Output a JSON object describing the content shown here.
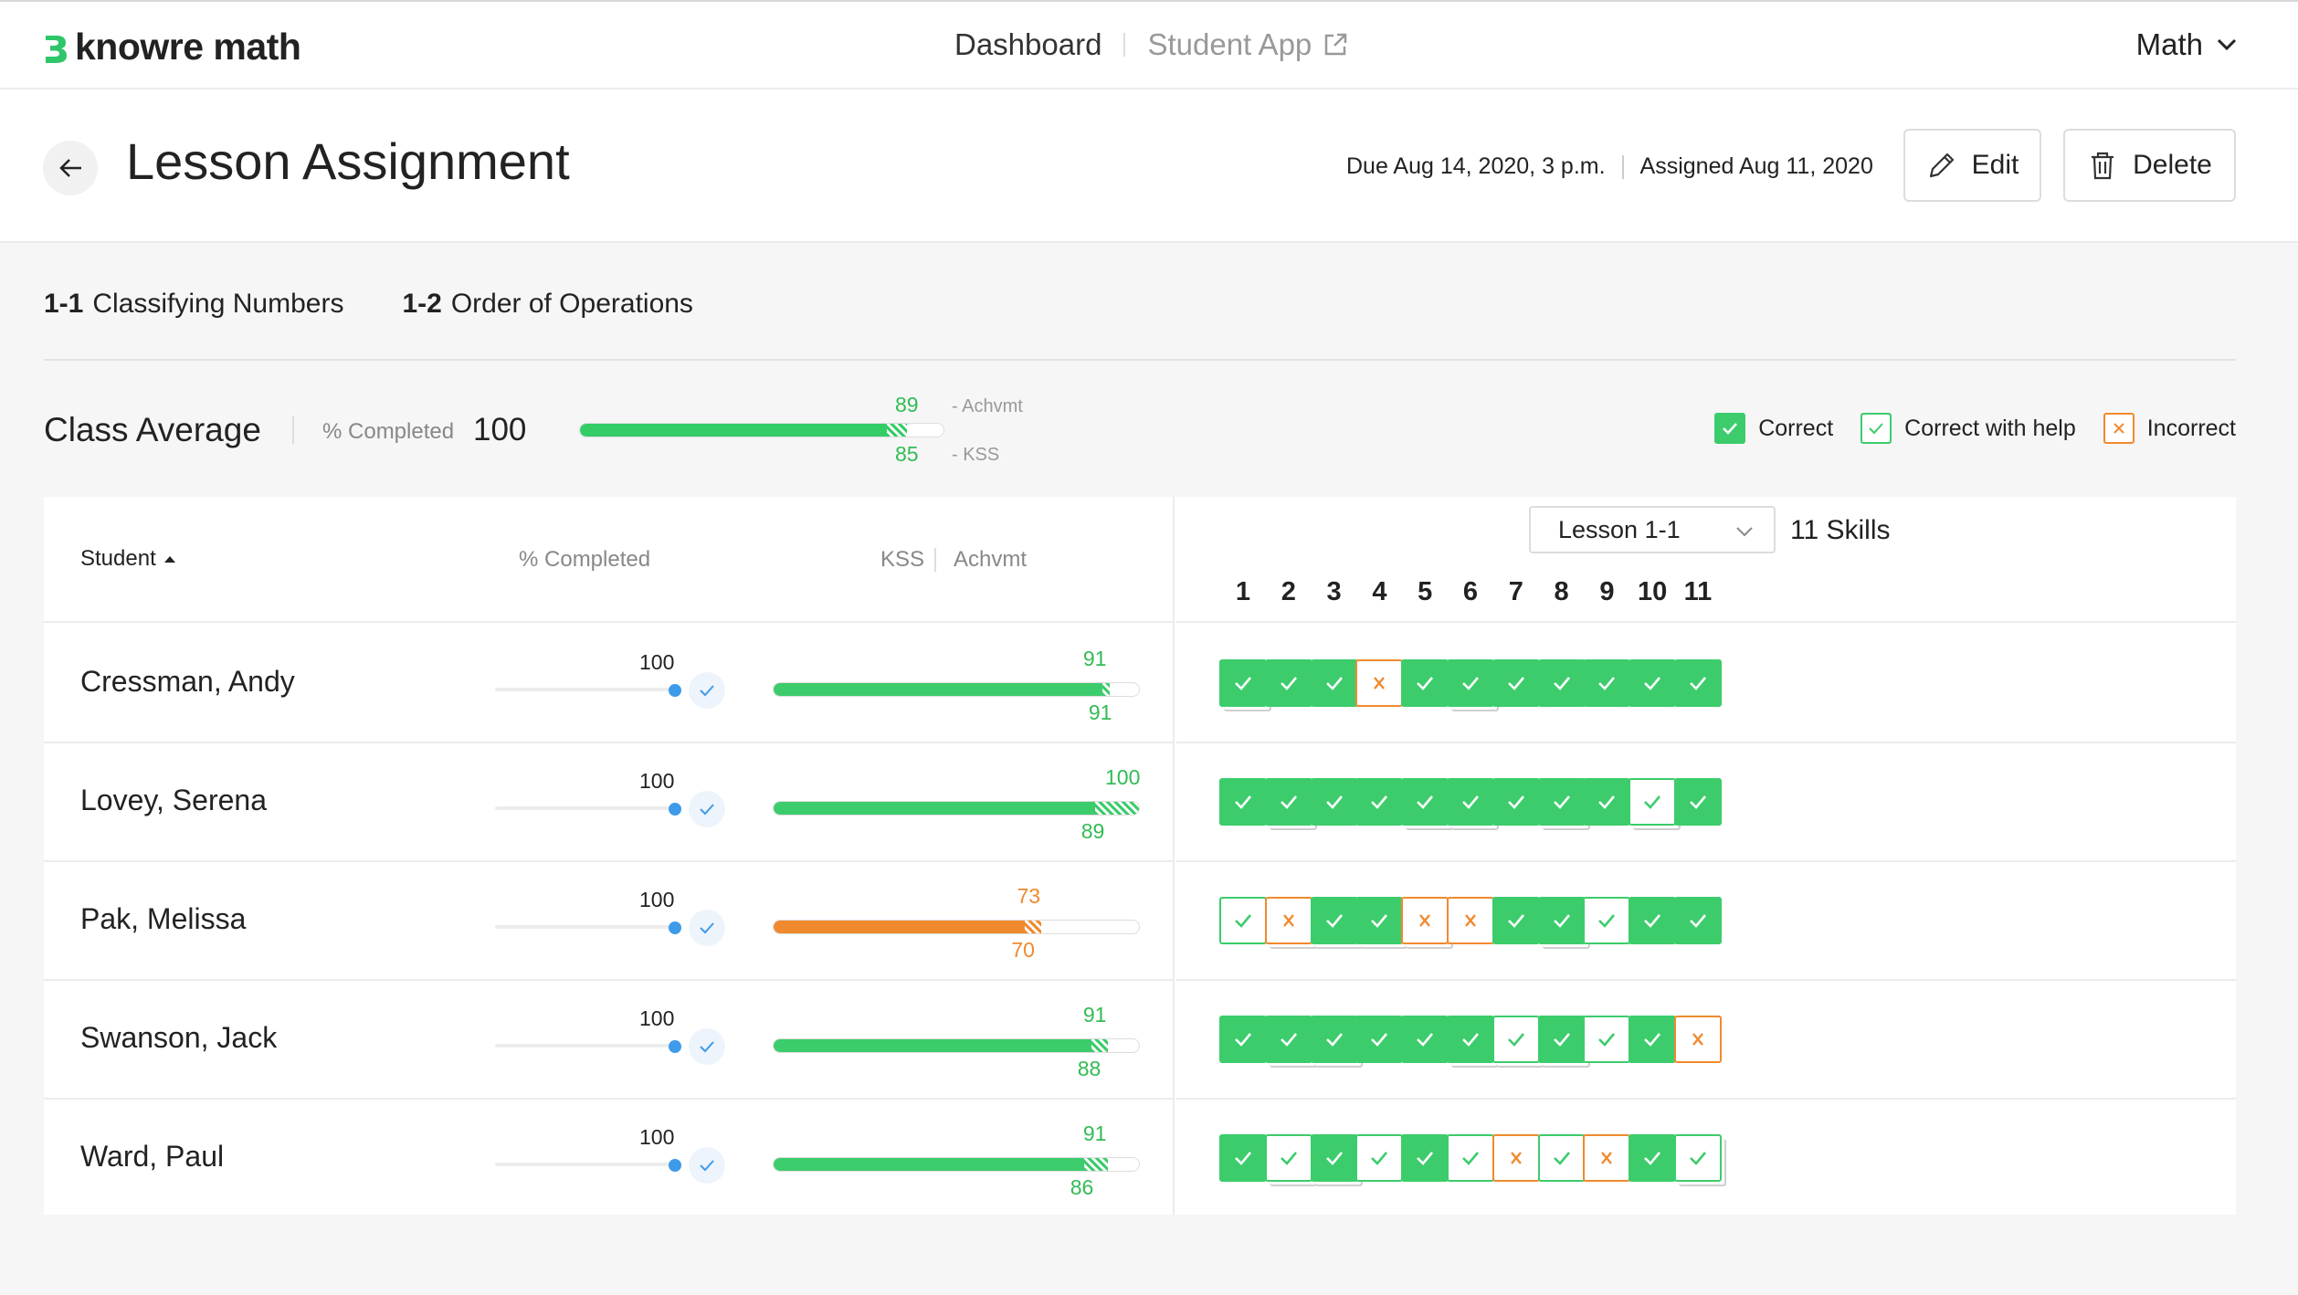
{
  "nav": {
    "logo": "knowre math",
    "dashboard": "Dashboard",
    "student_app": "Student App",
    "subject": "Math"
  },
  "header": {
    "title": "Lesson Assignment",
    "due": "Due Aug 14, 2020, 3 p.m.",
    "assigned": "Assigned Aug 11, 2020",
    "edit_label": "Edit",
    "delete_label": "Delete"
  },
  "lessons": [
    {
      "code": "1-1",
      "name": "Classifying Numbers"
    },
    {
      "code": "1-2",
      "name": "Order of Operations"
    }
  ],
  "class_average": {
    "title": "Class Average",
    "completed_label": "% Completed",
    "completed_value": "100",
    "achvmt": 89,
    "kss": 85,
    "achvmt_label": "- Achvmt",
    "kss_label": "- KSS"
  },
  "legend": {
    "correct": "Correct",
    "help": "Correct with help",
    "incorrect": "Incorrect"
  },
  "table": {
    "col_student": "Student",
    "col_completed": "% Completed",
    "col_kss": "KSS",
    "col_achvmt": "Achvmt",
    "lesson_select": "Lesson 1-1",
    "skills_count": "11 Skills",
    "skill_numbers": [
      "1",
      "2",
      "3",
      "4",
      "5",
      "6",
      "7",
      "8",
      "9",
      "10",
      "11"
    ]
  },
  "students": [
    {
      "name": "Cressman, Andy",
      "completed": "100",
      "achvmt": 91,
      "kss": 91,
      "status": "green",
      "skills": [
        "C",
        "C",
        "C",
        "I",
        "C",
        "C",
        "C",
        "C",
        "C",
        "C",
        "C"
      ],
      "stacked": [
        true,
        false,
        false,
        false,
        false,
        true,
        false,
        false,
        false,
        false,
        false
      ]
    },
    {
      "name": "Lovey, Serena",
      "completed": "100",
      "achvmt": 100,
      "kss": 89,
      "status": "green",
      "skills": [
        "C",
        "C",
        "C",
        "C",
        "C",
        "C",
        "C",
        "C",
        "C",
        "H",
        "C"
      ],
      "stacked": [
        false,
        true,
        false,
        false,
        true,
        true,
        false,
        true,
        false,
        true,
        false
      ]
    },
    {
      "name": "Pak, Melissa",
      "completed": "100",
      "achvmt": 73,
      "kss": 70,
      "status": "orange",
      "skills": [
        "H",
        "I",
        "C",
        "C",
        "I",
        "I",
        "C",
        "C",
        "H",
        "C",
        "C"
      ],
      "stacked": [
        false,
        true,
        true,
        true,
        true,
        false,
        false,
        true,
        false,
        false,
        false
      ]
    },
    {
      "name": "Swanson, Jack",
      "completed": "100",
      "achvmt": 91,
      "kss": 88,
      "status": "green",
      "skills": [
        "C",
        "C",
        "C",
        "C",
        "C",
        "C",
        "H",
        "C",
        "H",
        "C",
        "I"
      ],
      "stacked": [
        false,
        true,
        true,
        false,
        false,
        true,
        true,
        true,
        false,
        false,
        false
      ]
    },
    {
      "name": "Ward, Paul",
      "completed": "100",
      "achvmt": 91,
      "kss": 86,
      "status": "green",
      "skills": [
        "C",
        "H",
        "C",
        "H",
        "C",
        "H",
        "I",
        "H",
        "I",
        "C",
        "H"
      ],
      "stacked": [
        false,
        true,
        true,
        false,
        false,
        false,
        false,
        false,
        false,
        false,
        true
      ]
    }
  ],
  "colors": {
    "green": "#3ccc6c",
    "green_text": "#33bb55",
    "orange": "#f08a2e",
    "blue": "#3d9be9"
  },
  "icons": [
    "logo-icon",
    "external-link-icon",
    "chevron-down-icon",
    "back-arrow-icon",
    "pencil-icon",
    "trash-icon",
    "sort-up-icon",
    "check-icon",
    "x-icon"
  ]
}
